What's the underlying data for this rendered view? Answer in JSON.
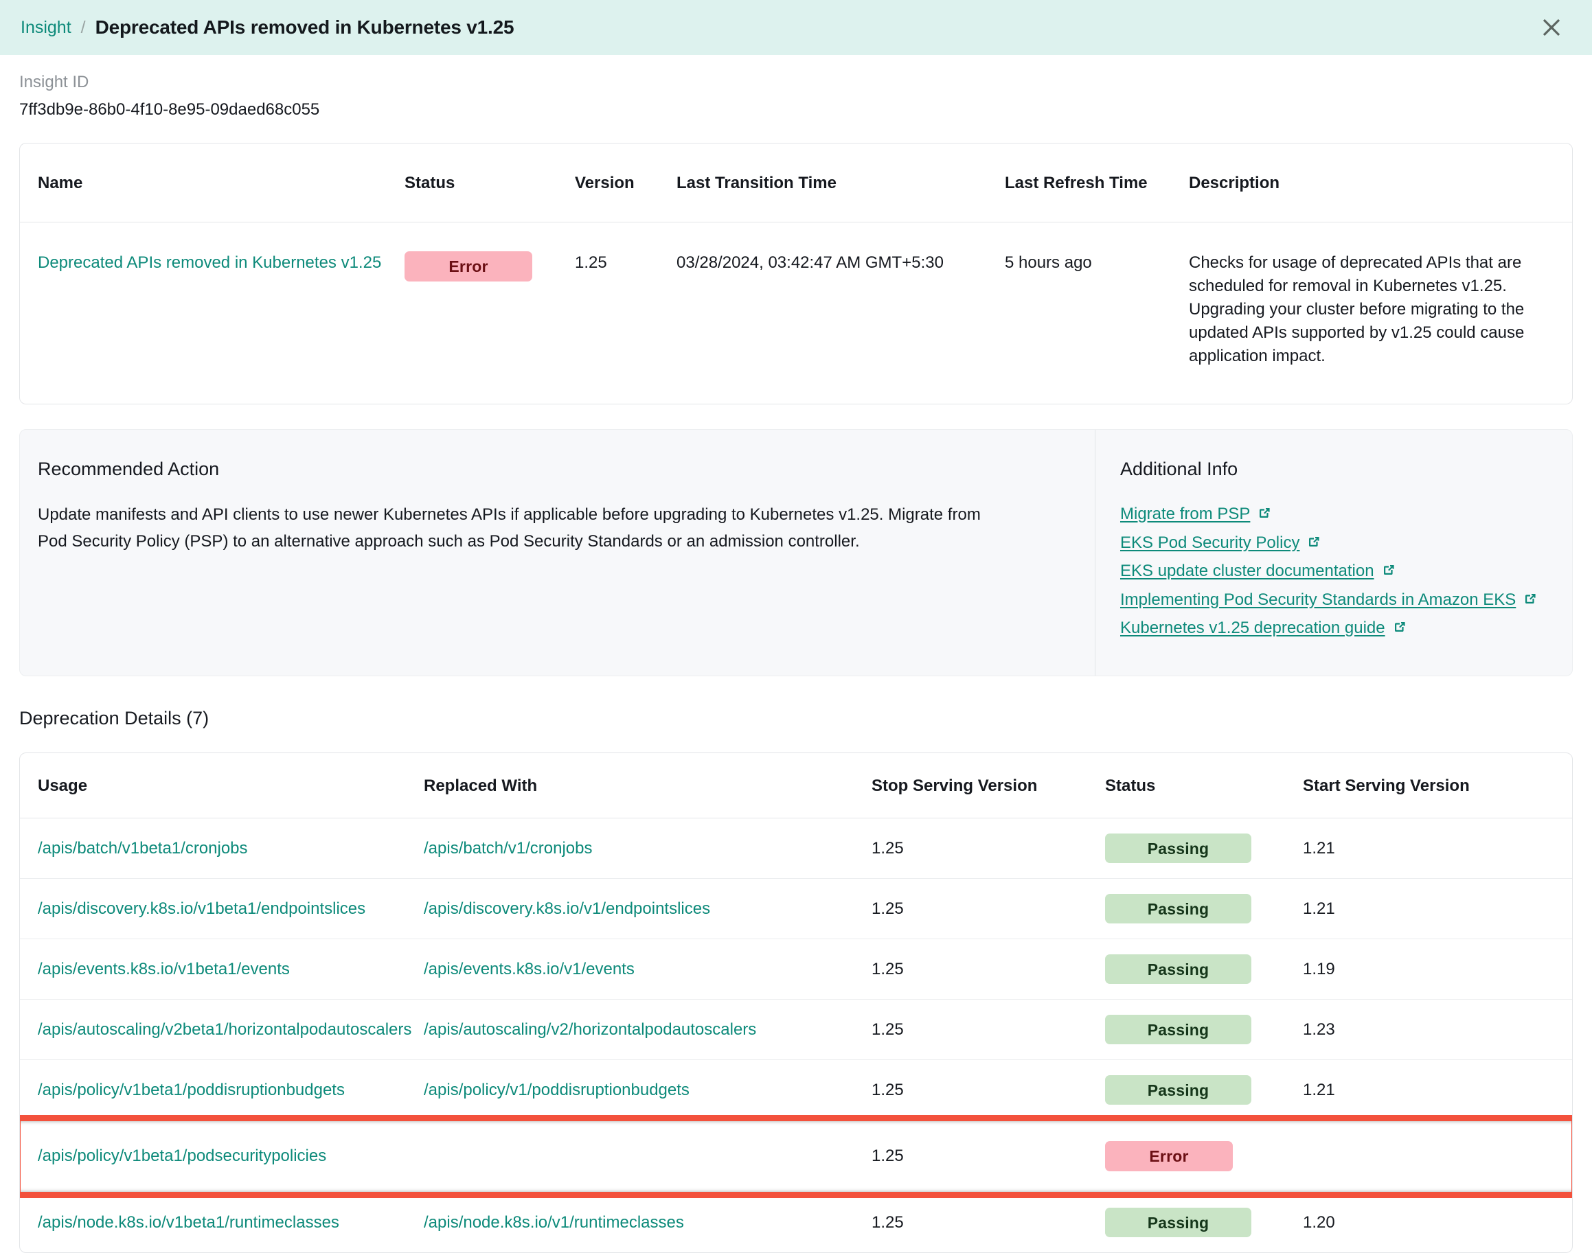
{
  "header": {
    "breadcrumb_parent": "Insight",
    "breadcrumb_separator": "/",
    "title": "Deprecated APIs removed in Kubernetes v1.25",
    "close_icon": "close-icon"
  },
  "insight_id": {
    "label": "Insight ID",
    "value": "7ff3db9e-86b0-4f10-8e95-09daed68c055"
  },
  "summary_table": {
    "columns": [
      "Name",
      "Status",
      "Version",
      "Last Transition Time",
      "Last Refresh Time",
      "Description"
    ],
    "rows": [
      {
        "name": "Deprecated APIs removed in Kubernetes v1.25",
        "status": "Error",
        "version": "1.25",
        "last_transition_time": "03/28/2024, 03:42:47 AM GMT+5:30",
        "last_refresh_time": "5 hours ago",
        "description": "Checks for usage of deprecated APIs that are scheduled for removal in Kubernetes v1.25. Upgrading your cluster before migrating to the updated APIs supported by v1.25 could cause application impact."
      }
    ]
  },
  "recommended_action": {
    "title": "Recommended Action",
    "body": "Update manifests and API clients to use newer Kubernetes APIs if applicable before upgrading to Kubernetes v1.25. Migrate from Pod Security Policy (PSP) to an alternative approach such as Pod Security Standards or an admission controller."
  },
  "additional_info": {
    "title": "Additional Info",
    "links": [
      "Migrate from PSP",
      "EKS Pod Security Policy",
      "EKS update cluster documentation",
      "Implementing Pod Security Standards in Amazon EKS",
      "Kubernetes v1.25 deprecation guide"
    ]
  },
  "deprecation_details": {
    "title": "Deprecation Details (7)",
    "columns": [
      "Usage",
      "Replaced With",
      "Stop Serving Version",
      "Status",
      "Start Serving Version"
    ],
    "rows": [
      {
        "usage": "/apis/batch/v1beta1/cronjobs",
        "replaced_with": "/apis/batch/v1/cronjobs",
        "stop_serving_version": "1.25",
        "status": "Passing",
        "start_serving_version": "1.21",
        "highlighted": false
      },
      {
        "usage": "/apis/discovery.k8s.io/v1beta1/endpointslices",
        "replaced_with": "/apis/discovery.k8s.io/v1/endpointslices",
        "stop_serving_version": "1.25",
        "status": "Passing",
        "start_serving_version": "1.21",
        "highlighted": false
      },
      {
        "usage": "/apis/events.k8s.io/v1beta1/events",
        "replaced_with": "/apis/events.k8s.io/v1/events",
        "stop_serving_version": "1.25",
        "status": "Passing",
        "start_serving_version": "1.19",
        "highlighted": false
      },
      {
        "usage": "/apis/autoscaling/v2beta1/horizontalpodautoscalers",
        "replaced_with": "/apis/autoscaling/v2/horizontalpodautoscalers",
        "stop_serving_version": "1.25",
        "status": "Passing",
        "start_serving_version": "1.23",
        "highlighted": false
      },
      {
        "usage": "/apis/policy/v1beta1/poddisruptionbudgets",
        "replaced_with": "/apis/policy/v1/poddisruptionbudgets",
        "stop_serving_version": "1.25",
        "status": "Passing",
        "start_serving_version": "1.21",
        "highlighted": false
      },
      {
        "usage": "/apis/policy/v1beta1/podsecuritypolicies",
        "replaced_with": "",
        "stop_serving_version": "1.25",
        "status": "Error",
        "start_serving_version": "",
        "highlighted": true
      },
      {
        "usage": "/apis/node.k8s.io/v1beta1/runtimeclasses",
        "replaced_with": "/apis/node.k8s.io/v1/runtimeclasses",
        "stop_serving_version": "1.25",
        "status": "Passing",
        "start_serving_version": "1.20",
        "highlighted": false
      }
    ]
  },
  "colors": {
    "header_band": "#ddf2ee",
    "teal_link": "#0d8a7a",
    "error_badge_bg": "#fbb3bd",
    "error_badge_text": "#6b0f14",
    "passing_badge_bg": "#c9e4c6",
    "passing_badge_text": "#15361a",
    "highlight_outline": "#f3513c",
    "panel_bg": "#f7f8fa"
  }
}
